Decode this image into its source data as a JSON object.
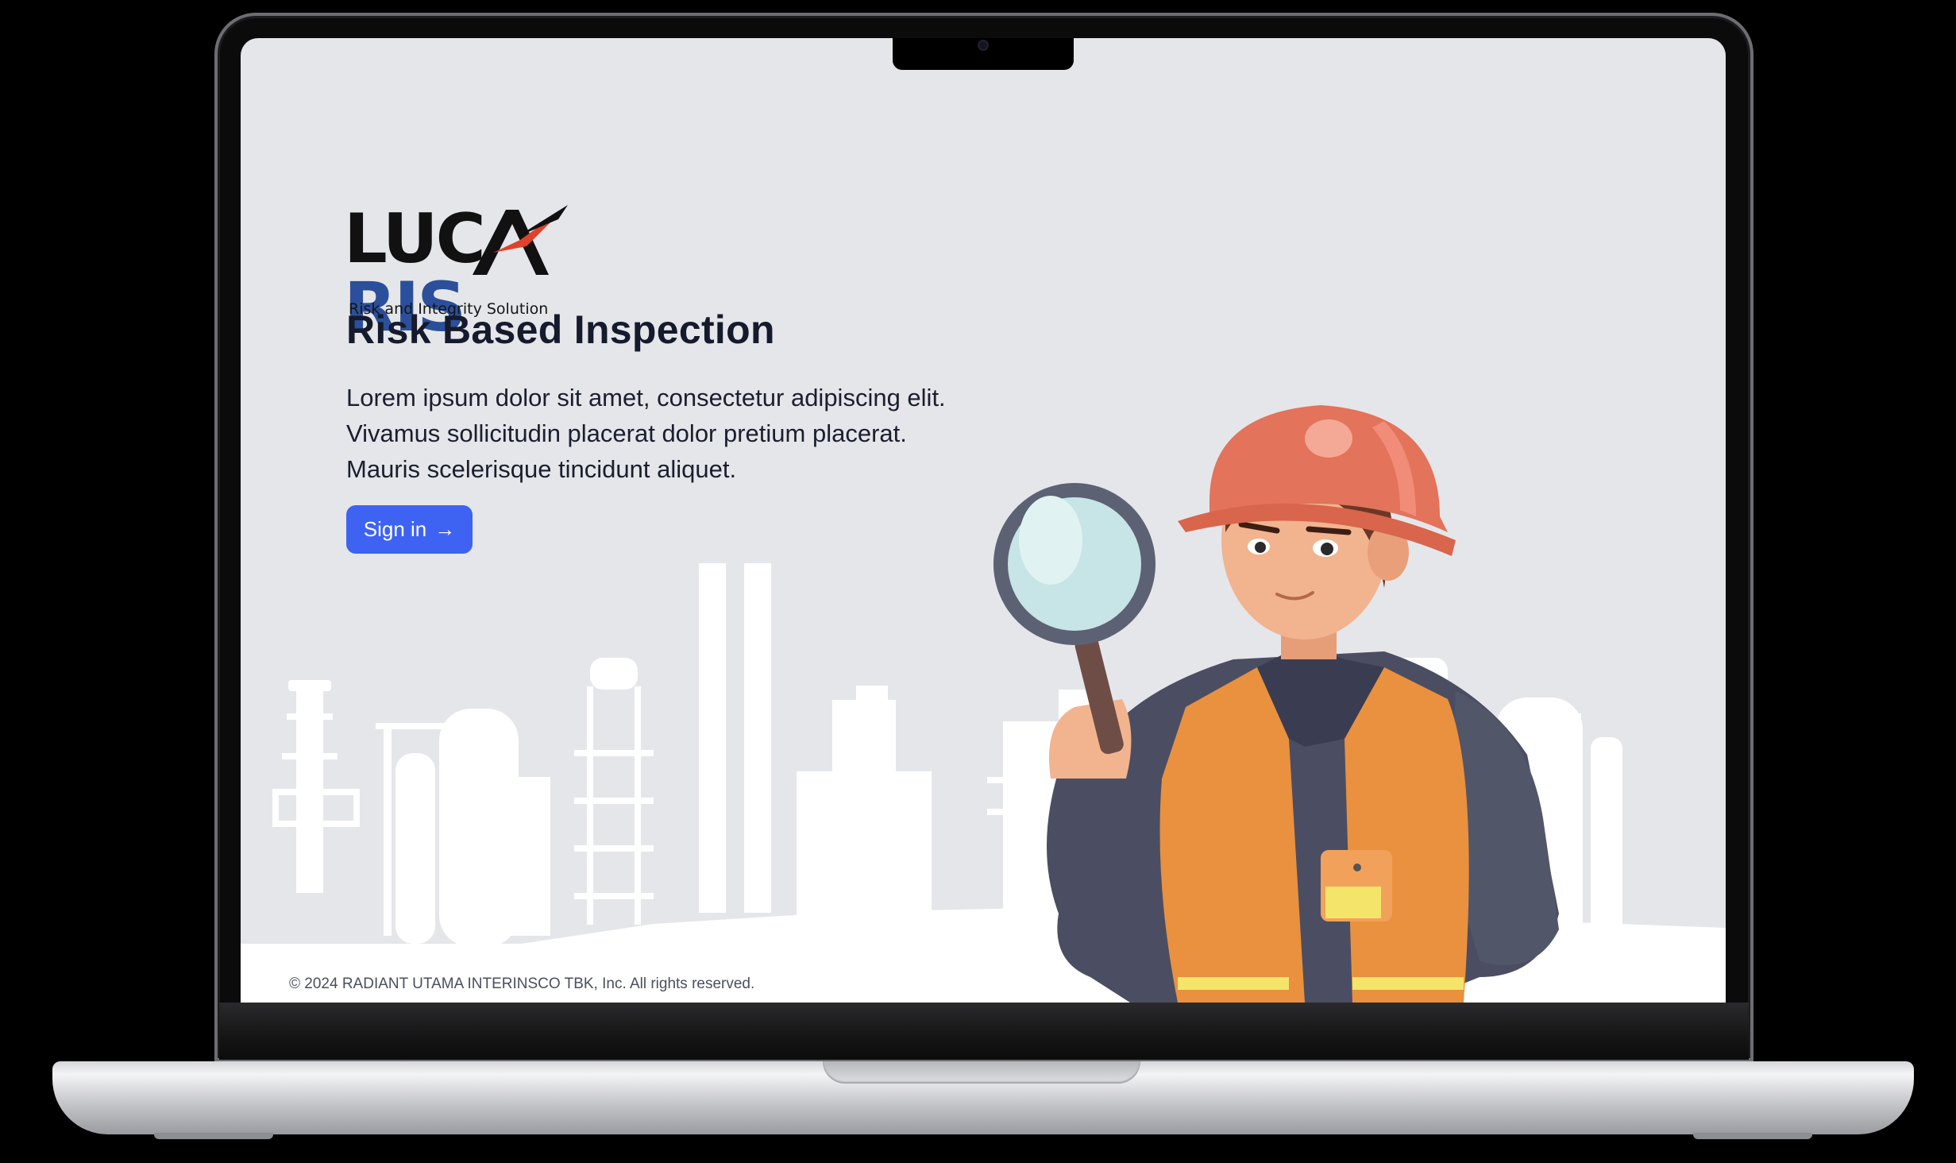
{
  "brand": {
    "logo_left": "LUC",
    "logo_right": "RIS",
    "tagline": "Risk and Integrity Solution",
    "logo_mark": "stylized-A-checkmark",
    "colors": {
      "dark": "#111111",
      "blue": "#2b4f9a",
      "red": "#e0412b"
    }
  },
  "hero": {
    "title": "Risk Based Inspection",
    "description_lines": [
      "Lorem ipsum dolor sit amet, consectetur adipiscing elit.",
      "Vivamus sollicitudin placerat dolor pretium placerat.",
      "Mauris scelerisque tincidunt aliquet."
    ],
    "signin_label": "Sign in",
    "signin_icon": "arrow-right-icon",
    "button_color": "#3e63f2"
  },
  "illustration": {
    "background": "refinery-skyline",
    "figure": "inspector-with-magnifying-glass"
  },
  "footer": {
    "copyright": "© 2024 RADIANT UTAMA INTERINSCO TBK, Inc. All rights reserved."
  },
  "screen_background": "#e5e6ea"
}
